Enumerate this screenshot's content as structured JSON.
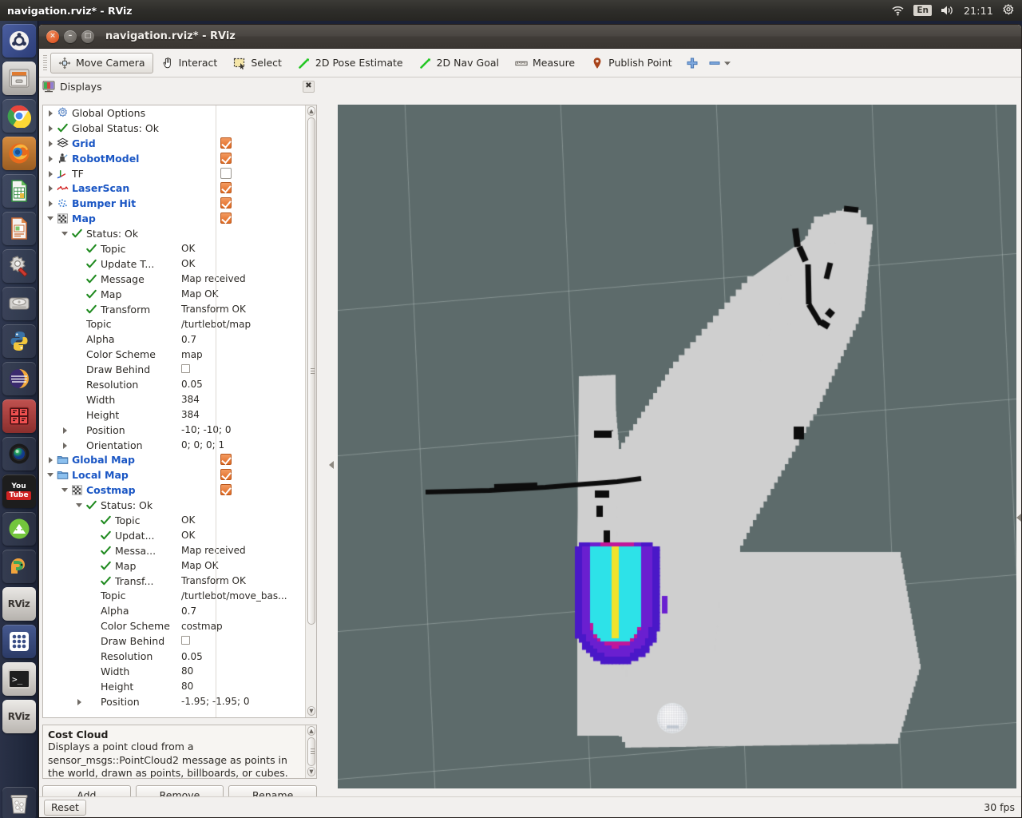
{
  "desktop": {
    "panel_title": "navigation.rviz* - RViz",
    "tray": {
      "wifi_icon": "wifi-icon",
      "keyboard_layout": "En",
      "volume_icon": "volume-icon",
      "clock": "21:11",
      "settings_icon": "gear-icon"
    },
    "launcher": [
      {
        "name": "ubuntu-dash-icon",
        "label": "Dash home"
      },
      {
        "name": "files-icon",
        "label": "Files"
      },
      {
        "name": "chrome-icon",
        "label": "Google Chrome"
      },
      {
        "name": "firefox-icon",
        "label": "Firefox"
      },
      {
        "name": "libreoffice-calc-icon",
        "label": "LibreOffice Calc"
      },
      {
        "name": "libreoffice-impress-icon",
        "label": "LibreOffice Impress"
      },
      {
        "name": "system-settings-icon",
        "label": "System Settings"
      },
      {
        "name": "disk-usage-icon",
        "label": "Disk Usage Analyzer"
      },
      {
        "name": "python-icon",
        "label": "Python"
      },
      {
        "name": "eclipse-icon",
        "label": "Eclipse"
      },
      {
        "name": "matlab-icon",
        "label": "MATLAB"
      },
      {
        "name": "webcam-icon",
        "label": "Camera"
      },
      {
        "name": "youtube-icon",
        "label": "YouTube"
      },
      {
        "name": "android-studio-icon",
        "label": "Android Studio"
      },
      {
        "name": "pycharm-icon",
        "label": "PyCharm"
      },
      {
        "name": "rviz-icon",
        "label": "RViz"
      },
      {
        "name": "apps-grid-icon",
        "label": "Applications"
      },
      {
        "name": "terminal-icon",
        "label": "Terminal"
      },
      {
        "name": "rviz-icon-2",
        "label": "RViz"
      },
      {
        "name": "trash-icon",
        "label": "Trash"
      }
    ]
  },
  "window": {
    "title": "navigation.rviz* - RViz",
    "close_label": "×",
    "minimize_label": "–",
    "maximize_label": "□"
  },
  "toolbar": {
    "items": [
      {
        "label": "Move Camera",
        "icon": "move-camera-icon",
        "checked": true
      },
      {
        "label": "Interact",
        "icon": "interact-hand-icon",
        "checked": false
      },
      {
        "label": "Select",
        "icon": "select-rectangle-icon",
        "checked": false
      },
      {
        "label": "2D Pose Estimate",
        "icon": "pose-estimate-arrow-icon",
        "checked": false
      },
      {
        "label": "2D Nav Goal",
        "icon": "nav-goal-arrow-icon",
        "checked": false
      },
      {
        "label": "Measure",
        "icon": "ruler-icon",
        "checked": false
      },
      {
        "label": "Publish Point",
        "icon": "map-pin-icon",
        "checked": false
      }
    ],
    "add_tool_label": "+",
    "remove_tool_label": "–"
  },
  "displays_panel": {
    "title": "Displays",
    "close_label": "✖",
    "rows": [
      {
        "indent": 0,
        "arrow": "closed",
        "icon": "gear-icon",
        "label": "Global Options",
        "value": "",
        "checkbox": null,
        "bold": false
      },
      {
        "indent": 0,
        "arrow": "closed",
        "icon": "check-icon",
        "label": "Global Status: Ok",
        "value": "",
        "checkbox": null,
        "bold": false
      },
      {
        "indent": 0,
        "arrow": "closed",
        "icon": "grid-icon",
        "label": "Grid",
        "value": "",
        "checkbox": true,
        "bold": true
      },
      {
        "indent": 0,
        "arrow": "closed",
        "icon": "robot-model-icon",
        "label": "RobotModel",
        "value": "",
        "checkbox": true,
        "bold": true
      },
      {
        "indent": 0,
        "arrow": "closed",
        "icon": "tf-axes-icon",
        "label": "TF",
        "value": "",
        "checkbox": false,
        "bold": false
      },
      {
        "indent": 0,
        "arrow": "closed",
        "icon": "laser-scan-icon",
        "label": "LaserScan",
        "value": "",
        "checkbox": true,
        "bold": true
      },
      {
        "indent": 0,
        "arrow": "closed",
        "icon": "point-cloud-icon",
        "label": "Bumper Hit",
        "value": "",
        "checkbox": true,
        "bold": true
      },
      {
        "indent": 0,
        "arrow": "open",
        "icon": "map-icon",
        "label": "Map",
        "value": "",
        "checkbox": true,
        "bold": true
      },
      {
        "indent": 1,
        "arrow": "open",
        "icon": "check-icon",
        "label": "Status: Ok",
        "value": "",
        "checkbox": null,
        "bold": false
      },
      {
        "indent": 2,
        "arrow": "none",
        "icon": "check-icon",
        "label": "Topic",
        "value": "OK",
        "checkbox": null,
        "bold": false
      },
      {
        "indent": 2,
        "arrow": "none",
        "icon": "check-icon",
        "label": "Update T...",
        "value": "OK",
        "checkbox": null,
        "bold": false
      },
      {
        "indent": 2,
        "arrow": "none",
        "icon": "check-icon",
        "label": "Message",
        "value": "Map received",
        "checkbox": null,
        "bold": false
      },
      {
        "indent": 2,
        "arrow": "none",
        "icon": "check-icon",
        "label": "Map",
        "value": "Map OK",
        "checkbox": null,
        "bold": false
      },
      {
        "indent": 2,
        "arrow": "none",
        "icon": "check-icon",
        "label": "Transform",
        "value": "Transform OK",
        "checkbox": null,
        "bold": false
      },
      {
        "indent": 1,
        "arrow": "none",
        "icon": "none",
        "label": "Topic",
        "value": "/turtlebot/map",
        "checkbox": null,
        "bold": false
      },
      {
        "indent": 1,
        "arrow": "none",
        "icon": "none",
        "label": "Alpha",
        "value": "0.7",
        "checkbox": null,
        "bold": false
      },
      {
        "indent": 1,
        "arrow": "none",
        "icon": "none",
        "label": "Color Scheme",
        "value": "map",
        "checkbox": null,
        "bold": false
      },
      {
        "indent": 1,
        "arrow": "none",
        "icon": "none",
        "label": "Draw Behind",
        "value": "__CHECKBOX__",
        "checkbox": null,
        "bold": false
      },
      {
        "indent": 1,
        "arrow": "none",
        "icon": "none",
        "label": "Resolution",
        "value": "0.05",
        "checkbox": null,
        "bold": false
      },
      {
        "indent": 1,
        "arrow": "none",
        "icon": "none",
        "label": "Width",
        "value": "384",
        "checkbox": null,
        "bold": false
      },
      {
        "indent": 1,
        "arrow": "none",
        "icon": "none",
        "label": "Height",
        "value": "384",
        "checkbox": null,
        "bold": false
      },
      {
        "indent": 1,
        "arrow": "closed",
        "icon": "none",
        "label": "Position",
        "value": "-10; -10; 0",
        "checkbox": null,
        "bold": false
      },
      {
        "indent": 1,
        "arrow": "closed",
        "icon": "none",
        "label": "Orientation",
        "value": "0; 0; 0; 1",
        "checkbox": null,
        "bold": false
      },
      {
        "indent": 0,
        "arrow": "closed",
        "icon": "folder-icon",
        "label": "Global Map",
        "value": "",
        "checkbox": true,
        "bold": true
      },
      {
        "indent": 0,
        "arrow": "open",
        "icon": "folder-icon",
        "label": "Local Map",
        "value": "",
        "checkbox": true,
        "bold": true
      },
      {
        "indent": 1,
        "arrow": "open",
        "icon": "map-icon",
        "label": "Costmap",
        "value": "",
        "checkbox": true,
        "bold": true
      },
      {
        "indent": 2,
        "arrow": "open",
        "icon": "check-icon",
        "label": "Status: Ok",
        "value": "",
        "checkbox": null,
        "bold": false
      },
      {
        "indent": 3,
        "arrow": "none",
        "icon": "check-icon",
        "label": "Topic",
        "value": "OK",
        "checkbox": null,
        "bold": false
      },
      {
        "indent": 3,
        "arrow": "none",
        "icon": "check-icon",
        "label": "Updat...",
        "value": "OK",
        "checkbox": null,
        "bold": false
      },
      {
        "indent": 3,
        "arrow": "none",
        "icon": "check-icon",
        "label": "Messa...",
        "value": "Map received",
        "checkbox": null,
        "bold": false
      },
      {
        "indent": 3,
        "arrow": "none",
        "icon": "check-icon",
        "label": "Map",
        "value": "Map OK",
        "checkbox": null,
        "bold": false
      },
      {
        "indent": 3,
        "arrow": "none",
        "icon": "check-icon",
        "label": "Transf...",
        "value": "Transform OK",
        "checkbox": null,
        "bold": false
      },
      {
        "indent": 2,
        "arrow": "none",
        "icon": "none",
        "label": "Topic",
        "value": "/turtlebot/move_bas...",
        "checkbox": null,
        "bold": false
      },
      {
        "indent": 2,
        "arrow": "none",
        "icon": "none",
        "label": "Alpha",
        "value": "0.7",
        "checkbox": null,
        "bold": false
      },
      {
        "indent": 2,
        "arrow": "none",
        "icon": "none",
        "label": "Color Scheme",
        "value": "costmap",
        "checkbox": null,
        "bold": false
      },
      {
        "indent": 2,
        "arrow": "none",
        "icon": "none",
        "label": "Draw Behind",
        "value": "__CHECKBOX__",
        "checkbox": null,
        "bold": false
      },
      {
        "indent": 2,
        "arrow": "none",
        "icon": "none",
        "label": "Resolution",
        "value": "0.05",
        "checkbox": null,
        "bold": false
      },
      {
        "indent": 2,
        "arrow": "none",
        "icon": "none",
        "label": "Width",
        "value": "80",
        "checkbox": null,
        "bold": false
      },
      {
        "indent": 2,
        "arrow": "none",
        "icon": "none",
        "label": "Height",
        "value": "80",
        "checkbox": null,
        "bold": false
      },
      {
        "indent": 2,
        "arrow": "closed",
        "icon": "none",
        "label": "Position",
        "value": "-1.95; -1.95; 0",
        "checkbox": null,
        "bold": false
      }
    ],
    "help": {
      "title": "Cost Cloud",
      "body": "Displays a point cloud from a sensor_msgs::PointCloud2 message as points in the world, drawn as points, billboards, or cubes."
    },
    "buttons": {
      "add": "Add",
      "remove": "Remove",
      "rename": "Rename"
    }
  },
  "status_bar": {
    "reset_label": "Reset",
    "fps": "30 fps"
  },
  "view": {
    "background_color": "#5d6b6b",
    "grid_color": "#b9c3c0",
    "map_free_color": "#cfcfcf",
    "map_occupied_color": "#0d0d0d",
    "robot_color": "#f7f8fa",
    "costmap_colors": [
      "#2de2e8",
      "#f0e32c",
      "#e8123c",
      "#c0179a",
      "#6a1fd0",
      "#4a18c8"
    ]
  }
}
